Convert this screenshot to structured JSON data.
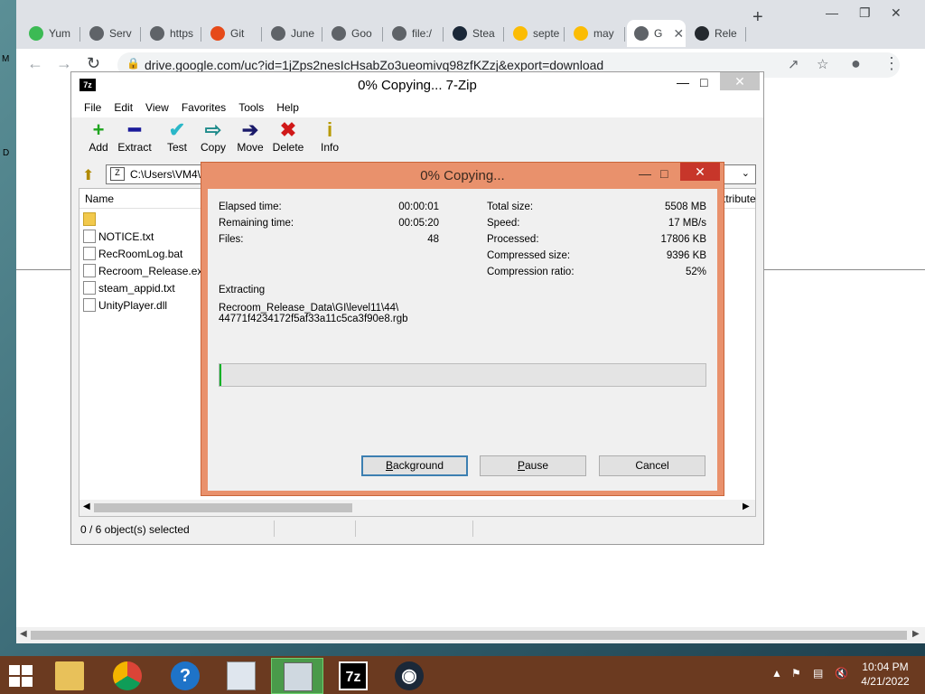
{
  "desktop": {
    "edge_m": "M",
    "edge_d": "D"
  },
  "browser": {
    "tabs": [
      {
        "label": "Yum",
        "color": "#3cba54"
      },
      {
        "label": "Serv",
        "color": "#5f6368"
      },
      {
        "label": "https",
        "color": "#5f6368"
      },
      {
        "label": "Git",
        "color": "#e64a19"
      },
      {
        "label": "June",
        "color": "#5f6368"
      },
      {
        "label": "Goo",
        "color": "#5f6368"
      },
      {
        "label": "file:/",
        "color": "#5f6368"
      },
      {
        "label": "Stea",
        "color": "#1b2838"
      },
      {
        "label": "septe",
        "color": "#fbbc04"
      },
      {
        "label": "may",
        "color": "#fbbc04"
      },
      {
        "label": "G",
        "color": "#5f6368"
      },
      {
        "label": "Rele",
        "color": "#24292e"
      }
    ],
    "url": "drive.google.com/uc?id=1jZps2nesIcHsabZo3ueomivq98zfKZzj&export=download"
  },
  "sevenzip": {
    "logo": "7z",
    "title": "0% Copying... 7-Zip",
    "menu": [
      "File",
      "Edit",
      "View",
      "Favorites",
      "Tools",
      "Help"
    ],
    "toolbar": [
      "Add",
      "Extract",
      "Test",
      "Copy",
      "Move",
      "Delete",
      "Info"
    ],
    "path": "C:\\Users\\VM4\\",
    "columns": {
      "name": "Name",
      "attributes": "ttribute"
    },
    "files": [
      "",
      "NOTICE.txt",
      "RecRoomLog.bat",
      "Recroom_Release.exe",
      "steam_appid.txt",
      "UnityPlayer.dll"
    ],
    "status": "0 / 6 object(s) selected"
  },
  "dialog": {
    "title": "0% Copying...",
    "elapsed_label": "Elapsed time:",
    "elapsed": "00:00:01",
    "remaining_label": "Remaining time:",
    "remaining": "00:05:20",
    "files_label": "Files:",
    "files": "48",
    "total_label": "Total size:",
    "total": "5508 MB",
    "speed_label": "Speed:",
    "speed": "17 MB/s",
    "processed_label": "Processed:",
    "processed": "17806 KB",
    "compressed_label": "Compressed size:",
    "compressed": "9396 KB",
    "ratio_label": "Compression ratio:",
    "ratio": "52%",
    "action": "Extracting",
    "current_file_1": "Recroom_Release_Data\\GI\\level11\\44\\",
    "current_file_2": "44771f4234172f5af33a11c5ca3f90e8.rgb",
    "progress_fraction": 0.004,
    "buttons": {
      "background_u": "B",
      "background_rest": "ackground",
      "pause_u": "P",
      "pause_rest": "ause",
      "cancel": "Cancel"
    }
  },
  "taskbar": {
    "clock_time": "10:04 PM",
    "clock_date": "4/21/2022",
    "items": [
      "File Explorer",
      "Chrome",
      "Help",
      "Monitor",
      "Installer",
      "7-Zip",
      "Steam"
    ]
  }
}
